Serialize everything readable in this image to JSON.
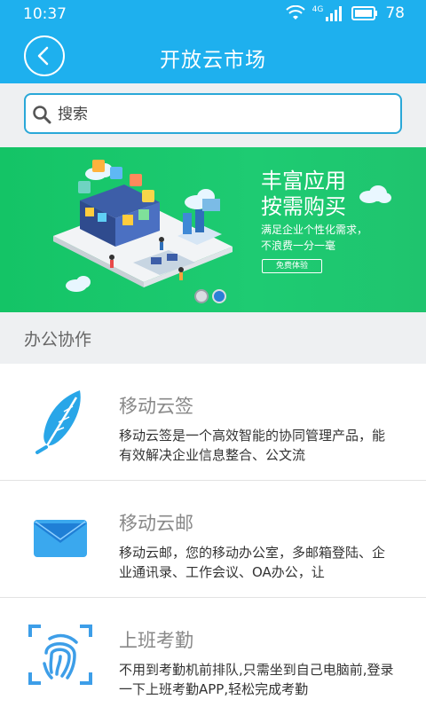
{
  "status": {
    "time": "10:37",
    "network": "4G",
    "battery": "78"
  },
  "header": {
    "title": "开放云市场"
  },
  "search": {
    "placeholder": "搜索"
  },
  "banner": {
    "title": "丰富应用\n按需购买",
    "subtitle": "满足企业个性化需求，\n不浪费一分一毫",
    "button_label": "免费体验",
    "slide_count": 2,
    "active_slide": 2
  },
  "section": {
    "title": "办公协作"
  },
  "apps": [
    {
      "name": "移动云签",
      "desc": "移动云签是一个高效智能的协同管理产品，能有效解决企业信息整合、公文流",
      "icon": "feather-icon"
    },
    {
      "name": "移动云邮",
      "desc": "移动云邮，您的移动办公室，多邮箱登陆、企业通讯录、工作会议、OA办公，让",
      "icon": "mail-icon"
    },
    {
      "name": "上班考勤",
      "desc": "不用到考勤机前排队,只需坐到自己电脑前,登录一下上班考勤APP,轻松完成考勤",
      "icon": "fingerprint-icon"
    }
  ],
  "colors": {
    "primary": "#1eb0ee",
    "banner": "#1ecb72",
    "background": "#eef0f2"
  }
}
